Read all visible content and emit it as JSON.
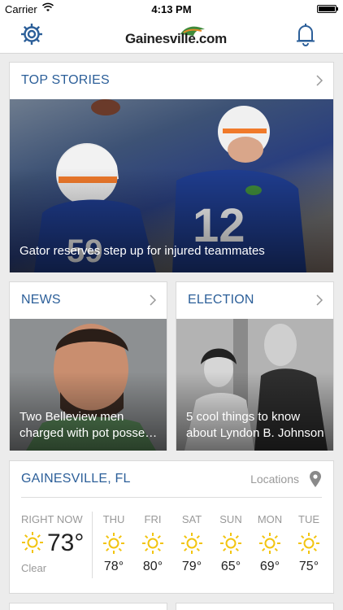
{
  "status_bar": {
    "carrier": "Carrier",
    "time": "4:13 PM"
  },
  "nav": {
    "logo_text": "Gainesville.com"
  },
  "top_stories": {
    "title": "TOP STORIES",
    "caption": "Gator reserves step up for injured teammates"
  },
  "news": {
    "title": "NEWS",
    "caption": "Two Belleview men charged with pot posse…"
  },
  "election": {
    "title": "ELECTION",
    "caption": "5 cool things to know about Lyndon B. Johnson"
  },
  "weather": {
    "city": "GAINESVILLE, FL",
    "locations_label": "Locations",
    "now_label": "RIGHT NOW",
    "now_temp": "73°",
    "now_condition": "Clear",
    "days": [
      {
        "name": "THU",
        "temp": "78°"
      },
      {
        "name": "FRI",
        "temp": "80°"
      },
      {
        "name": "SAT",
        "temp": "79°"
      },
      {
        "name": "SUN",
        "temp": "65°"
      },
      {
        "name": "MON",
        "temp": "69°"
      },
      {
        "name": "TUE",
        "temp": "75°"
      }
    ]
  },
  "colors": {
    "accent": "#2c5f99",
    "sun": "#f2c40f",
    "background": "#ececec"
  }
}
